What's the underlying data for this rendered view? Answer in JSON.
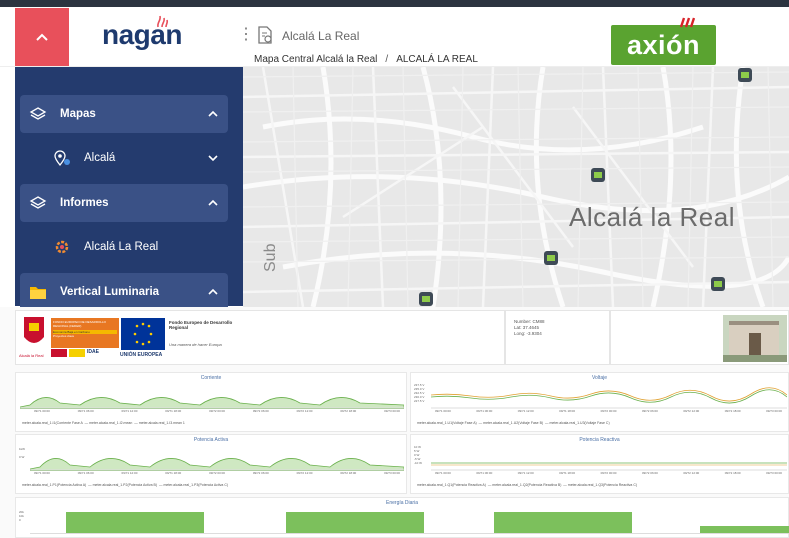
{
  "header": {
    "logo_text": "nagan",
    "page_title": "Alcalá La Real",
    "breadcrumb": [
      "Mapa Central Alcalá la Real",
      "ALCALÁ LA REAL"
    ],
    "brand_right": "axión",
    "accent_color": "#e8505b",
    "brand_green": "#5aa330"
  },
  "sidebar": {
    "items": [
      {
        "label": "Mapas",
        "icon": "layers-icon",
        "type": "section",
        "chevron": "up"
      },
      {
        "label": "Alcalá",
        "icon": "map-pin-icon",
        "type": "sub",
        "chevron": "down"
      },
      {
        "label": "Informes",
        "icon": "layers-icon",
        "type": "section",
        "chevron": "up"
      },
      {
        "label": "Alcalá La Real",
        "icon": "gear-report-icon",
        "type": "sub"
      },
      {
        "label": "Vertical Luminaria",
        "icon": "folder-icon",
        "type": "section",
        "chevron": "up"
      }
    ]
  },
  "map": {
    "city_label": "Alcalá la Real",
    "road_label": "Sub"
  },
  "dashboard": {
    "logos": {
      "left_badge": "Alcalá la Real",
      "eu_fund_title": "Fondo Europeo de Desarrollo Regional",
      "eu_fund_motto": "Una manera de hacer Europa",
      "eu_label": "UNIÓN EUROPEA",
      "idae_label": "IDAE",
      "fund_box_line1": "FONDO EUROPEO DE DESARROLLO REGIONAL (FEDER)",
      "fund_box_line2": "Economía Baja en Carbono",
      "fund_box_line3": "Proyectos clave"
    },
    "info": {
      "number": "Number: CM88",
      "lat": "Lat: 37.4645",
      "long": "Long: -3.9304"
    },
    "charts": [
      {
        "title": "Corriente",
        "legend": [
          "meter.alcala.real_1.I1(Corriente Fase A",
          "meter.alcala.real_1.I2.mean",
          "meter.alcala.real_1.I3.mean 1"
        ]
      },
      {
        "title": "Voltaje",
        "legend": [
          "meter.alcala.real_1.U1(Voltaje Fase A)",
          "meter.alcala.real_1.U2(Voltaje Fase B)",
          "meter.alcala.real_1.U3(Voltaje Fase C)"
        ]
      },
      {
        "title": "Potencia Activa",
        "legend": [
          "meter.alcala.real_1.P1(Potencia Activa A)",
          "meter.alcala.real_1.P2(Potencia Activa B)",
          "meter.alcala.real_1.P3(Potencia Activa C)"
        ]
      },
      {
        "title": "Potencia Reactiva",
        "legend": [
          "meter.alcala.real_1.Q1(Potencia Reactiva A)",
          "meter.alcala.real_1.Q2(Potencia Reactiva B)",
          "meter.alcala.real_1.Q3(Potencia Reactiva C)"
        ]
      },
      {
        "title": "Energía Diaria",
        "legend": []
      }
    ],
    "time_ticks": [
      "09/71 00:00",
      "09/71 06:00",
      "09/71 12:00",
      "09/71 18:00",
      "09/72 00:00",
      "09/72 06:00",
      "09/72 12:00",
      "09/72 18:00",
      "09/73 00:00"
    ]
  }
}
